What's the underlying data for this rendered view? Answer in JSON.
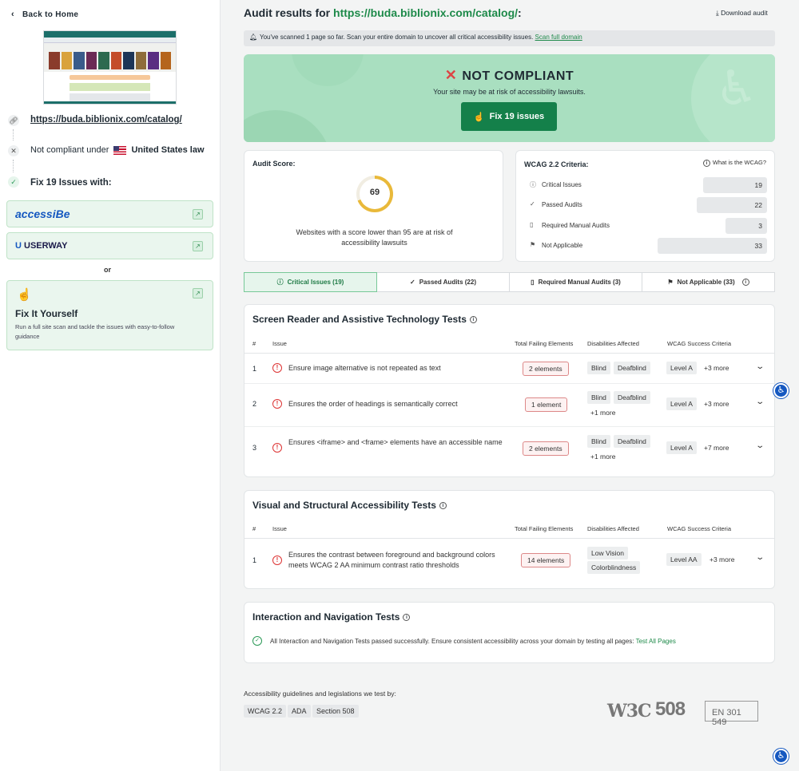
{
  "sidebar": {
    "back_label": "Back to Home",
    "site_url": "https://buda.biblionix.com/catalog/",
    "not_compliant_label": "Not compliant under",
    "law": "United States law",
    "fix_title": "Fix 19 Issues with:",
    "vendors": [
      "accessiBe",
      "USERWAY"
    ],
    "or_label": "or",
    "fix_yourself_title": "Fix It Yourself",
    "fix_yourself_desc": "Run a full site scan and tackle the issues with easy-to-follow guidance"
  },
  "header": {
    "title_prefix": "Audit results for",
    "title_url": "https://buda.biblionix.com/catalog/",
    "title_suffix": ":",
    "download_label": "Download audit"
  },
  "notice": {
    "text": "You've scanned 1 page so far. Scan your entire domain to uncover all critical accessibility issues.",
    "link": "Scan full domain"
  },
  "banner": {
    "status": "NOT COMPLIANT",
    "subtitle": "Your site may be at risk of accessibility lawsuits.",
    "button": "Fix 19 issues",
    "colors": {
      "accent": "#14804a",
      "background": "#a9dfc0",
      "error": "#dd4444"
    }
  },
  "score": {
    "label": "Audit Score:",
    "value": "69",
    "fraction": 0.69,
    "caption": "Websites with a score lower than 95 are at risk of accessibility lawsuits"
  },
  "wcag": {
    "label": "WCAG 2.2 Criteria:",
    "what_link": "What is the WCAG?",
    "rows": [
      {
        "icon": "info-icon",
        "name": "Critical Issues",
        "count": "19"
      },
      {
        "icon": "check-icon",
        "name": "Passed Audits",
        "count": "22"
      },
      {
        "icon": "document-icon",
        "name": "Required Manual Audits",
        "count": "3"
      },
      {
        "icon": "flag-icon",
        "name": "Not Applicable",
        "count": "33"
      }
    ]
  },
  "tabs": [
    {
      "label": "Critical Issues (19)",
      "icon": "info-icon"
    },
    {
      "label": "Passed Audits (22)",
      "icon": "check-icon"
    },
    {
      "label": "Required Manual Audits (3)",
      "icon": "document-icon"
    },
    {
      "label": "Not Applicable (33)",
      "icon": "flag-icon"
    }
  ],
  "table_headers": [
    "#",
    "Issue",
    "Total Failing Elements",
    "Disabilities Affected",
    "WCAG Success Criteria"
  ],
  "sections": [
    {
      "title": "Screen Reader and Assistive Technology Tests",
      "rows": [
        {
          "num": "1",
          "issue": "Ensure image alternative is not repeated as text",
          "elements": "2 elements",
          "tags": [
            "Blind",
            "Deafblind"
          ],
          "extra": "",
          "level": "Level A",
          "more": "+3 more"
        },
        {
          "num": "2",
          "issue": "Ensures the order of headings is semantically correct",
          "elements": "1 element",
          "tags": [
            "Blind",
            "Deafblind"
          ],
          "extra": "+1 more",
          "level": "Level A",
          "more": "+3 more"
        },
        {
          "num": "3",
          "issue": "Ensures <iframe> and <frame> elements have an accessible name",
          "elements": "2 elements",
          "tags": [
            "Blind",
            "Deafblind"
          ],
          "extra": "+1 more",
          "level": "Level A",
          "more": "+7 more"
        }
      ]
    },
    {
      "title": "Visual and Structural Accessibility Tests",
      "rows": [
        {
          "num": "1",
          "issue": "Ensures the contrast between foreground and background colors meets WCAG 2 AA minimum contrast ratio thresholds",
          "elements": "14 elements",
          "tags": [
            "Low Vision",
            "Colorblindness"
          ],
          "extra": "",
          "level": "Level AA",
          "more": "+3 more"
        }
      ]
    },
    {
      "title": "Interaction and Navigation Tests",
      "passed_text": "All Interaction and Navigation Tests passed successfully. Ensure consistent accessibility across your domain by testing all pages:",
      "passed_link": "Test All Pages"
    }
  ],
  "footer": {
    "tested_by": "Accessibility guidelines and legislations we test by:",
    "standards": [
      "WCAG 2.2",
      "ADA",
      "Section 508"
    ],
    "logos": [
      "W3C",
      "508",
      "EN 301 549"
    ]
  }
}
